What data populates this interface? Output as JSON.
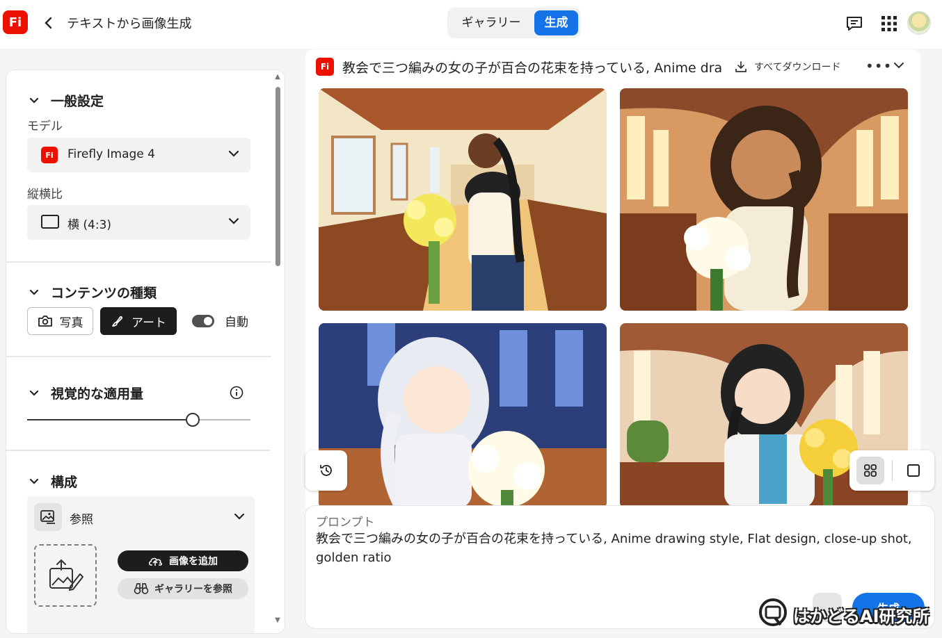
{
  "header": {
    "app_logo": "Fi",
    "title": "テキストから画像生成",
    "tabs": {
      "gallery": "ギャラリー",
      "generate": "生成"
    }
  },
  "sidebar": {
    "general": {
      "heading": "一般設定",
      "model_label": "モデル",
      "model_value": "Firefly Image 4",
      "aspect_label": "縦横比",
      "aspect_value": "横 (4:3)"
    },
    "content_type": {
      "heading": "コンテンツの種類",
      "photo": "写真",
      "art": "アート",
      "auto": "自動",
      "selected": "アート",
      "auto_enabled": true
    },
    "visual_intensity": {
      "heading": "視覚的な適用量",
      "value_fraction": 0.74
    },
    "composition": {
      "heading": "構成",
      "reference_label": "参照",
      "add_image": "画像を追加",
      "browse_gallery": "ギャラリーを参照"
    }
  },
  "results": {
    "title": "教会で三つ編みの女の子が百合の花束を持っている, Anime drawing style, Flat design, close-up shot, golden ratio",
    "download_all": "すべてダウンロード"
  },
  "prompt": {
    "label": "プロンプト",
    "text": "教会で三つ編みの女の子が百合の花束を持っている, Anime drawing style, Flat design, close-up shot, golden ratio",
    "generate_button": "生成"
  },
  "watermark": "はかどるAI研究所",
  "colors": {
    "brand_red": "#eb1000",
    "accent_blue": "#1473e6",
    "dark": "#1d1d1d"
  },
  "icons": {
    "back": "chevron-left-icon",
    "chat": "chat-icon",
    "apps": "apps-grid-icon",
    "history": "history-icon",
    "info": "info-icon",
    "download": "download-icon"
  }
}
